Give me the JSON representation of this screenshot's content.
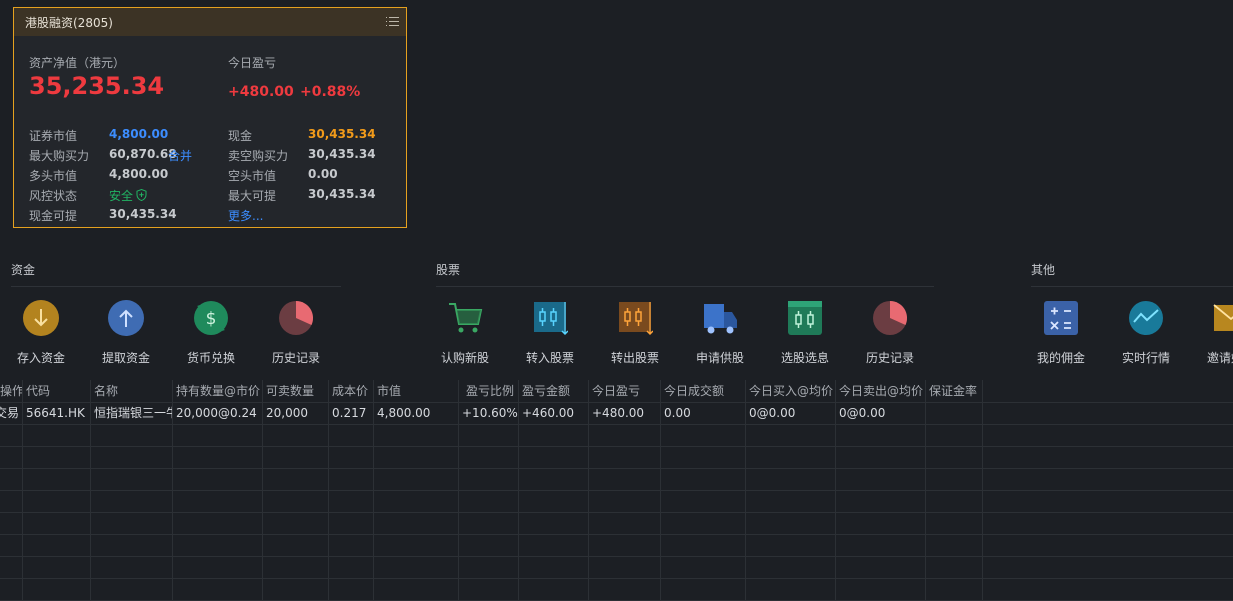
{
  "account": {
    "title": "港股融资(2805)",
    "net_label": "资产净值（港元）",
    "net_value": "35,235.34",
    "pnl_label": "今日盈亏",
    "pnl_value": "+480.00",
    "pnl_pct": "+0.88%",
    "securities_label": "证券市值",
    "securities_value": "4,800.00",
    "max_buy_label": "最大购买力",
    "max_buy_value": "60,870.68",
    "merge_label": "合并",
    "long_label": "多头市值",
    "long_value": "4,800.00",
    "risk_label": "风控状态",
    "risk_value": "安全",
    "cash_withdraw_label": "现金可提",
    "cash_withdraw_value": "30,435.34",
    "cash_label": "现金",
    "cash_value": "30,435.34",
    "short_buy_label": "卖空购买力",
    "short_buy_value": "30,435.34",
    "short_label": "空头市值",
    "short_value": "0.00",
    "max_withdraw_label": "最大可提",
    "max_withdraw_value": "30,435.34",
    "more_label": "更多..."
  },
  "sections": {
    "funds": "资金",
    "stocks": "股票",
    "other": "其他"
  },
  "tools": {
    "deposit": "存入资金",
    "withdraw": "提取资金",
    "exchange": "货币兑换",
    "fund_history": "历史记录",
    "ipo": "认购新股",
    "transfer_in": "转入股票",
    "transfer_out": "转出股票",
    "lend": "申请供股",
    "screener": "选股选息",
    "stock_history": "历史记录",
    "commission": "我的佣金",
    "quotes": "实时行情",
    "invite": "邀请好友"
  },
  "colors": {
    "accent": "#e5a11f",
    "up": "#ee3a3f",
    "link": "#3c8dff",
    "safe": "#21b363"
  },
  "positions": {
    "headers": [
      "操作",
      "代码",
      "名称",
      "持有数量@市价",
      "可卖数量",
      "成本价",
      "市值",
      "盈亏比例",
      "盈亏金额",
      "今日盈亏",
      "今日成交额",
      "今日买入@均价",
      "今日卖出@均价",
      "保证金率"
    ],
    "row": {
      "op": "交易",
      "code": "56641.HK",
      "name": "恒指瑞银三一牛",
      "qty": "20,000@0.24",
      "sellable": "20,000",
      "cost": "0.217",
      "mv": "4,800.00",
      "pnl_ratio": "+10.60%",
      "pnl_amount": "+460.00",
      "today_pnl": "+480.00",
      "today_turnover": "0.00",
      "today_buy": "0@0.00",
      "today_sell": "0@0.00",
      "margin_rate": ""
    }
  }
}
